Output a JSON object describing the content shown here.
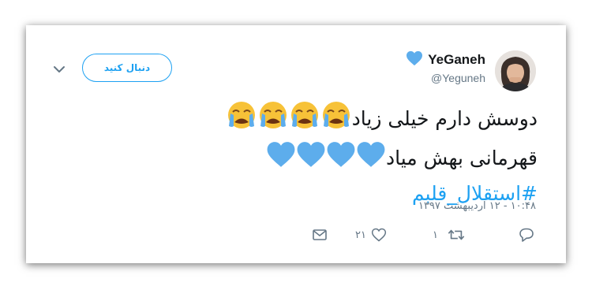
{
  "tweet": {
    "display_name": "YeGaneh",
    "handle": "@Yeguneh",
    "follow_label": "دنبال کنید",
    "line1_text": "دوسش دارم خیلی زیاد",
    "line2_text": "قهرمانی بهش میاد",
    "hashtag": "#استقلال_قلبم",
    "line1_emojis": [
      "crying-face",
      "crying-face",
      "crying-face",
      "crying-face"
    ],
    "line2_emojis": [
      "blue-heart",
      "blue-heart",
      "blue-heart",
      "blue-heart"
    ],
    "timestamp": "۱۰:۴۸ - ۱۲ اردیبهشت ۱۳۹۷",
    "reply_count": "",
    "retweet_count": "۱",
    "like_count": "۲۱"
  },
  "colors": {
    "accent": "#1da1f2",
    "heart": "#5dadec",
    "muted": "#657786",
    "text": "#14171a"
  }
}
